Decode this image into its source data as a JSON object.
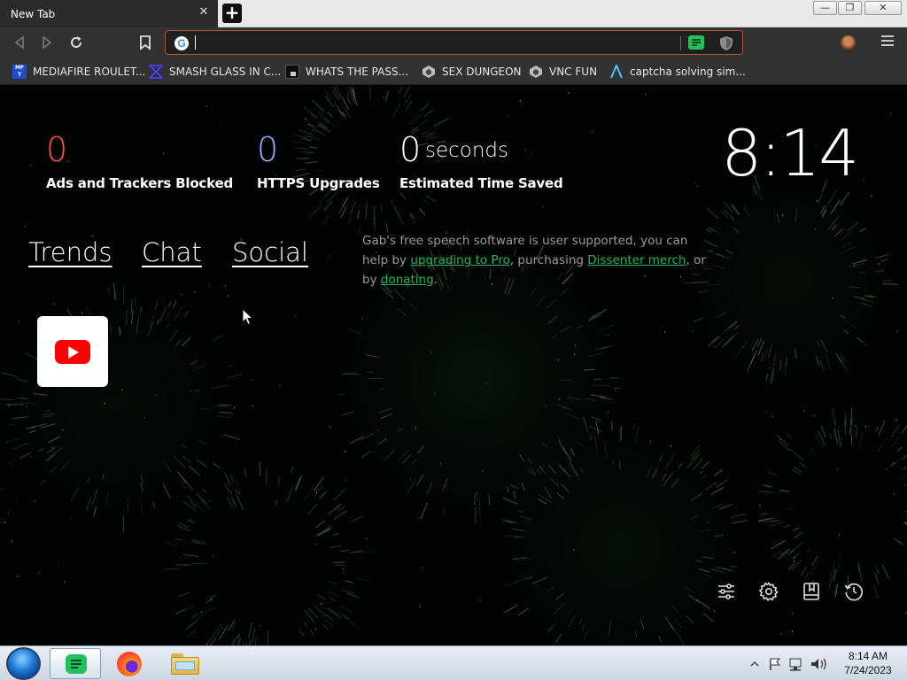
{
  "browser": {
    "tab": {
      "title": "New Tab",
      "close_symbol": "✕"
    },
    "new_tab_symbol": "+",
    "window_controls": {
      "minimize": "—",
      "restore": "❐",
      "close": "✕"
    },
    "omnibox": {
      "value": "",
      "placeholder": ""
    },
    "bookmarks": [
      {
        "label": "MEDIAFIRE ROULET...",
        "icon": "mediafire-icon",
        "icon_color": "#1f4bd6"
      },
      {
        "label": "SMASH GLASS IN C...",
        "icon": "smash-glass-icon",
        "icon_color": "#3c2fd1"
      },
      {
        "label": "WHATS THE PASS...",
        "icon": "lock-site-icon",
        "icon_color": "#1a1a1a"
      },
      {
        "label": "SEX DUNGEON",
        "icon": "game-icon",
        "icon_color": "#bdbdbd"
      },
      {
        "label": "VNC FUN",
        "icon": "game-icon",
        "icon_color": "#bdbdbd"
      },
      {
        "label": "captcha solving sim...",
        "icon": "captcha-icon",
        "icon_color": "#4cc3ff"
      }
    ]
  },
  "stats": {
    "ads_blocked": {
      "value": "0",
      "label": "Ads and Trackers Blocked",
      "color": "#f2572b"
    },
    "https_upgrades": {
      "value": "0",
      "label": "HTTPS Upgrades",
      "color": "#a3a4f5"
    },
    "time_saved": {
      "value": "0",
      "unit": "seconds",
      "label": "Estimated Time Saved",
      "color": "#ffffff"
    }
  },
  "clock": "8:14",
  "links": {
    "trends": "Trends",
    "chat": "Chat",
    "social": "Social"
  },
  "gab_message": {
    "text1": "Gab's free speech software is user supported, you can help by ",
    "link1": "upgrading to Pro",
    "text2": ", purchasing ",
    "link2": "Dissenter merch",
    "text3": ", or by ",
    "link3": "donating",
    "text4": "."
  },
  "top_sites": [
    {
      "name": "YouTube",
      "icon": "youtube-icon"
    }
  ],
  "toolbar_icons": [
    "customize-icon",
    "settings-icon",
    "bookmarks-icon",
    "history-icon"
  ],
  "taskbar": {
    "apps": [
      "dissenter-icon",
      "firefox-icon",
      "file-explorer-icon"
    ],
    "time": "8:14 AM",
    "date": "7/24/2023"
  }
}
